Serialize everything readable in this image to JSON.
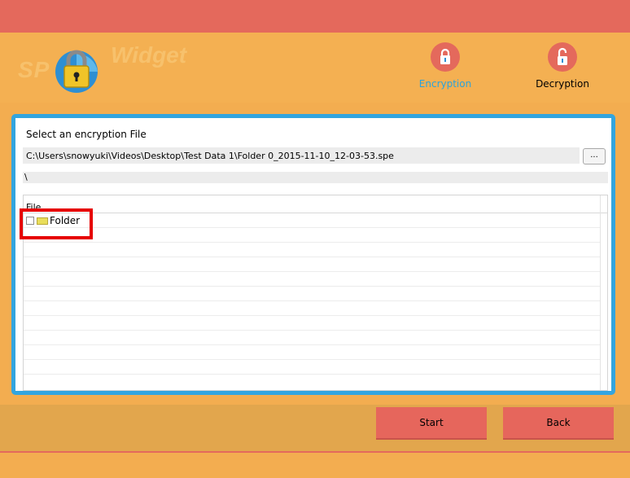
{
  "app": {
    "logo_text_left": "SP",
    "logo_text_right": "Widget"
  },
  "nav": {
    "encryption_label": "Encryption",
    "decryption_label": "Decryption",
    "encryption_icon": "lock-closed-icon",
    "decryption_icon": "lock-open-icon"
  },
  "panel": {
    "select_label": "Select an encryption File",
    "file_path": "C:\\Users\\snowyuki\\Videos\\Desktop\\Test Data 1\\Folder 0_2015-11-10_12-03-53.spe",
    "browse_label": "...",
    "sub_path": "\\",
    "tree": {
      "column_header": "File",
      "items": [
        {
          "label": "Folder",
          "checked": false,
          "icon": "folder-icon"
        }
      ]
    }
  },
  "buttons": {
    "start_label": "Start",
    "back_label": "Back"
  },
  "colors": {
    "accent_blue": "#33a5df",
    "header_red": "#e4695c",
    "background_orange": "#f3ad50",
    "highlight_red": "#e60000"
  }
}
